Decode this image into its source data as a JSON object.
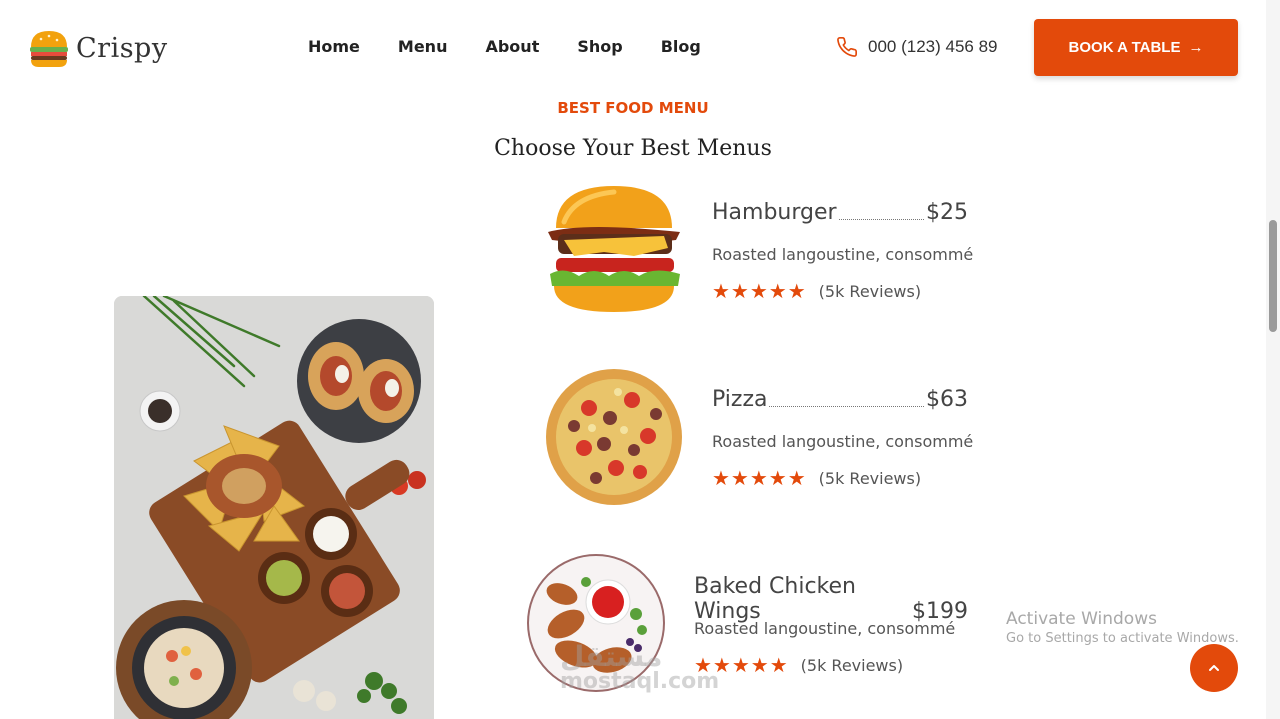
{
  "brand": {
    "name": "Crispy",
    "logo_icon": "burger-icon"
  },
  "nav": {
    "items": [
      {
        "label": "Home"
      },
      {
        "label": "Menu"
      },
      {
        "label": "About"
      },
      {
        "label": "Shop"
      },
      {
        "label": "Blog"
      }
    ]
  },
  "contact": {
    "phone": "000 (123) 456 89",
    "icon": "phone-icon"
  },
  "cta": {
    "label": "BOOK A TABLE",
    "arrow": "→"
  },
  "section": {
    "eyebrow": "BEST FOOD MENU",
    "title": "Choose Your Best Menus"
  },
  "menu": {
    "items": [
      {
        "name": "Hamburger",
        "price": "$25",
        "description": "Roasted langoustine, consommé",
        "stars": "★★★★★",
        "rating": 5,
        "reviews": "(5k Reviews)",
        "image": "hamburger-image"
      },
      {
        "name": "Pizza",
        "price": "$63",
        "description": "Roasted langoustine, consommé",
        "stars": "★★★★★",
        "rating": 5,
        "reviews": "(5k Reviews)",
        "image": "pizza-image"
      },
      {
        "name": "Baked Chicken Wings",
        "price": "$199",
        "description": "Roasted langoustine, consommé",
        "stars": "★★★★★",
        "rating": 5,
        "reviews": "(5k Reviews)",
        "image": "chicken-wings-image"
      }
    ]
  },
  "overlay": {
    "activate_title": "Activate Windows",
    "activate_sub": "Go to Settings to activate Windows.",
    "scroll_top_icon": "chevron-up-icon"
  },
  "watermark": {
    "line1": "مستقل",
    "line2": "mostaql.com"
  },
  "colors": {
    "accent": "#e34a0b",
    "text": "#222222",
    "muted": "#555555"
  }
}
